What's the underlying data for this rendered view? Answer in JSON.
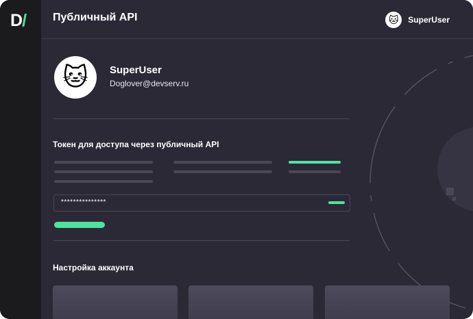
{
  "app": {
    "logo_letter": "D",
    "logo_slash": "/"
  },
  "header": {
    "title": "Публичный API",
    "user": {
      "name": "SuperUser",
      "avatar_icon": "cat-face-icon",
      "avatar_glyph": "🐱"
    }
  },
  "profile": {
    "name": "SuperUser",
    "email": "Doglover@devserv.ru",
    "avatar_icon": "cat-face-icon",
    "avatar_glyph": "🐱"
  },
  "token_section": {
    "title": "Токен для доступа через публичный API",
    "token_value": "***************"
  },
  "account_section": {
    "title": "Настройка аккаунта"
  },
  "colors": {
    "accent": "#4fe3a0",
    "background": "#2b2936",
    "sidebar": "#1b1b1d"
  }
}
